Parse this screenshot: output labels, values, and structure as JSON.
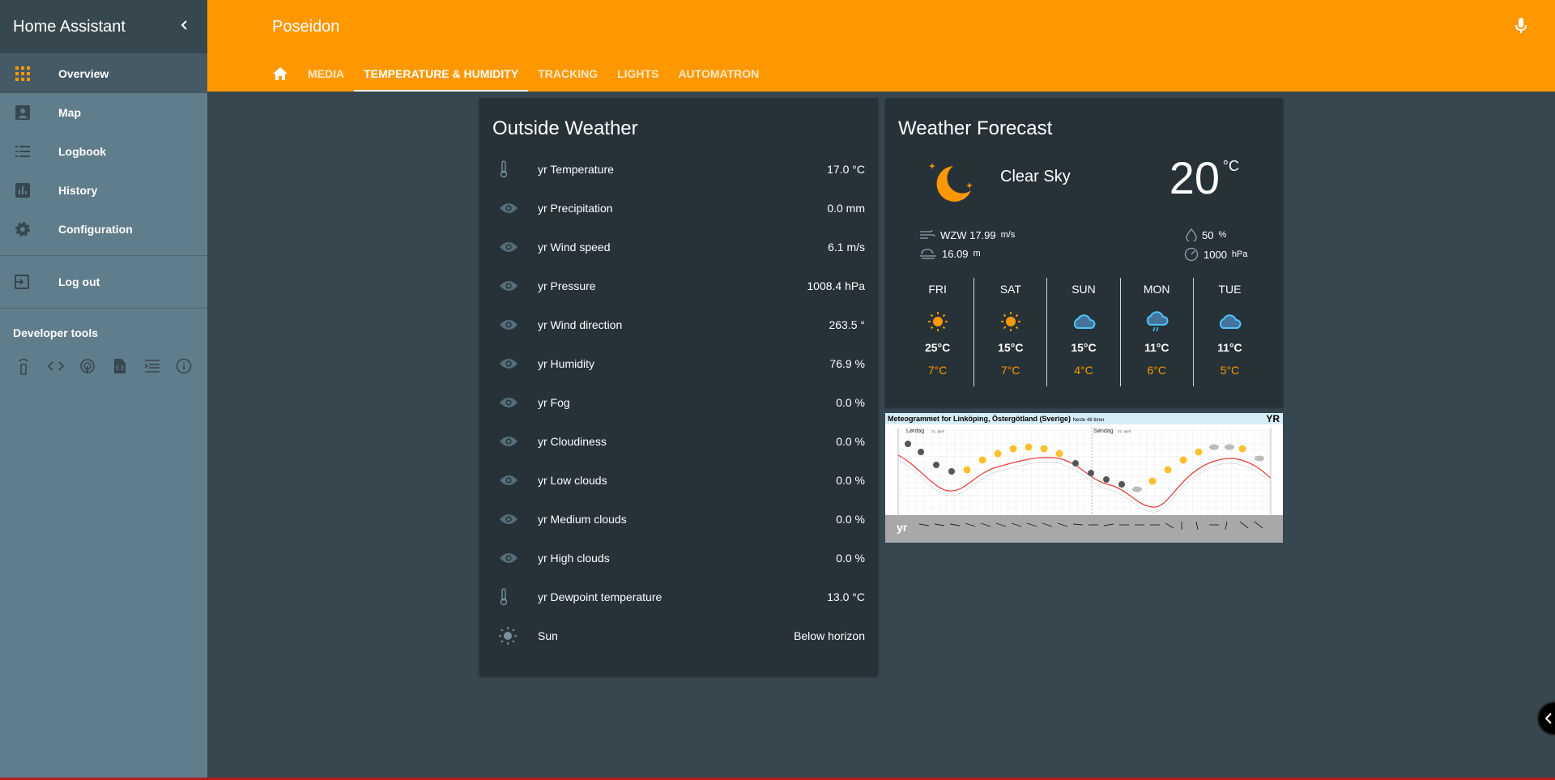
{
  "sidebar": {
    "title": "Home Assistant",
    "items": [
      {
        "label": "Overview",
        "icon": "apps-icon"
      },
      {
        "label": "Map",
        "icon": "map-icon"
      },
      {
        "label": "Logbook",
        "icon": "logbook-icon"
      },
      {
        "label": "History",
        "icon": "history-icon"
      },
      {
        "label": "Configuration",
        "icon": "settings-icon"
      }
    ],
    "logout": "Log out",
    "dev_tools_title": "Developer tools"
  },
  "header": {
    "title": "Poseidon",
    "tabs": [
      "MEDIA",
      "TEMPERATURE & HUMIDITY",
      "TRACKING",
      "LIGHTS",
      "AUTOMATRON"
    ]
  },
  "outside_weather": {
    "title": "Outside Weather",
    "entities": [
      {
        "name": "yr Temperature",
        "value": "17.0 °C",
        "icon": "thermometer-icon"
      },
      {
        "name": "yr Precipitation",
        "value": "0.0 mm",
        "icon": "eye-icon"
      },
      {
        "name": "yr Wind speed",
        "value": "6.1 m/s",
        "icon": "eye-icon"
      },
      {
        "name": "yr Pressure",
        "value": "1008.4 hPa",
        "icon": "eye-icon"
      },
      {
        "name": "yr Wind direction",
        "value": "263.5 °",
        "icon": "eye-icon"
      },
      {
        "name": "yr Humidity",
        "value": "76.9 %",
        "icon": "eye-icon"
      },
      {
        "name": "yr Fog",
        "value": "0.0 %",
        "icon": "eye-icon"
      },
      {
        "name": "yr Cloudiness",
        "value": "0.0 %",
        "icon": "eye-icon"
      },
      {
        "name": "yr Low clouds",
        "value": "0.0 %",
        "icon": "eye-icon"
      },
      {
        "name": "yr Medium clouds",
        "value": "0.0 %",
        "icon": "eye-icon"
      },
      {
        "name": "yr High clouds",
        "value": "0.0 %",
        "icon": "eye-icon"
      },
      {
        "name": "yr Dewpoint temperature",
        "value": "13.0 °C",
        "icon": "thermometer-icon"
      },
      {
        "name": "Sun",
        "value": "Below horizon",
        "icon": "sun-icon"
      }
    ]
  },
  "forecast": {
    "title": "Weather Forecast",
    "condition": "Clear Sky",
    "temperature": "20",
    "temp_unit": "°C",
    "wind": "WZW 17.99",
    "wind_unit": "m/s",
    "visibility": "16.09",
    "visibility_unit": "m",
    "humidity": "50",
    "humidity_unit": "%",
    "pressure": "1000",
    "pressure_unit": "hPa",
    "days": [
      {
        "day": "FRI",
        "hi": "25°C",
        "lo": "7°C",
        "icon": "sunny-icon"
      },
      {
        "day": "SAT",
        "hi": "15°C",
        "lo": "7°C",
        "icon": "sunny-icon"
      },
      {
        "day": "SUN",
        "hi": "15°C",
        "lo": "4°C",
        "icon": "cloudy-icon"
      },
      {
        "day": "MON",
        "hi": "11°C",
        "lo": "6°C",
        "icon": "rainy-icon"
      },
      {
        "day": "TUE",
        "hi": "11°C",
        "lo": "5°C",
        "icon": "cloudy-icon"
      }
    ]
  },
  "meteogram": {
    "title": "Meteogrammet for Linköping, Östergötland (Sverige)",
    "subtitle": "Neste 48 timer",
    "logo": "YR",
    "day1": "Lørdag",
    "day1_date": "21. april",
    "day2": "Søndag",
    "day2_date": "22. april",
    "yr_mark": "yr"
  },
  "colors": {
    "accent": "#ff9800",
    "sidebar": "#607d8b",
    "card": "#263238",
    "background": "#37474f"
  }
}
